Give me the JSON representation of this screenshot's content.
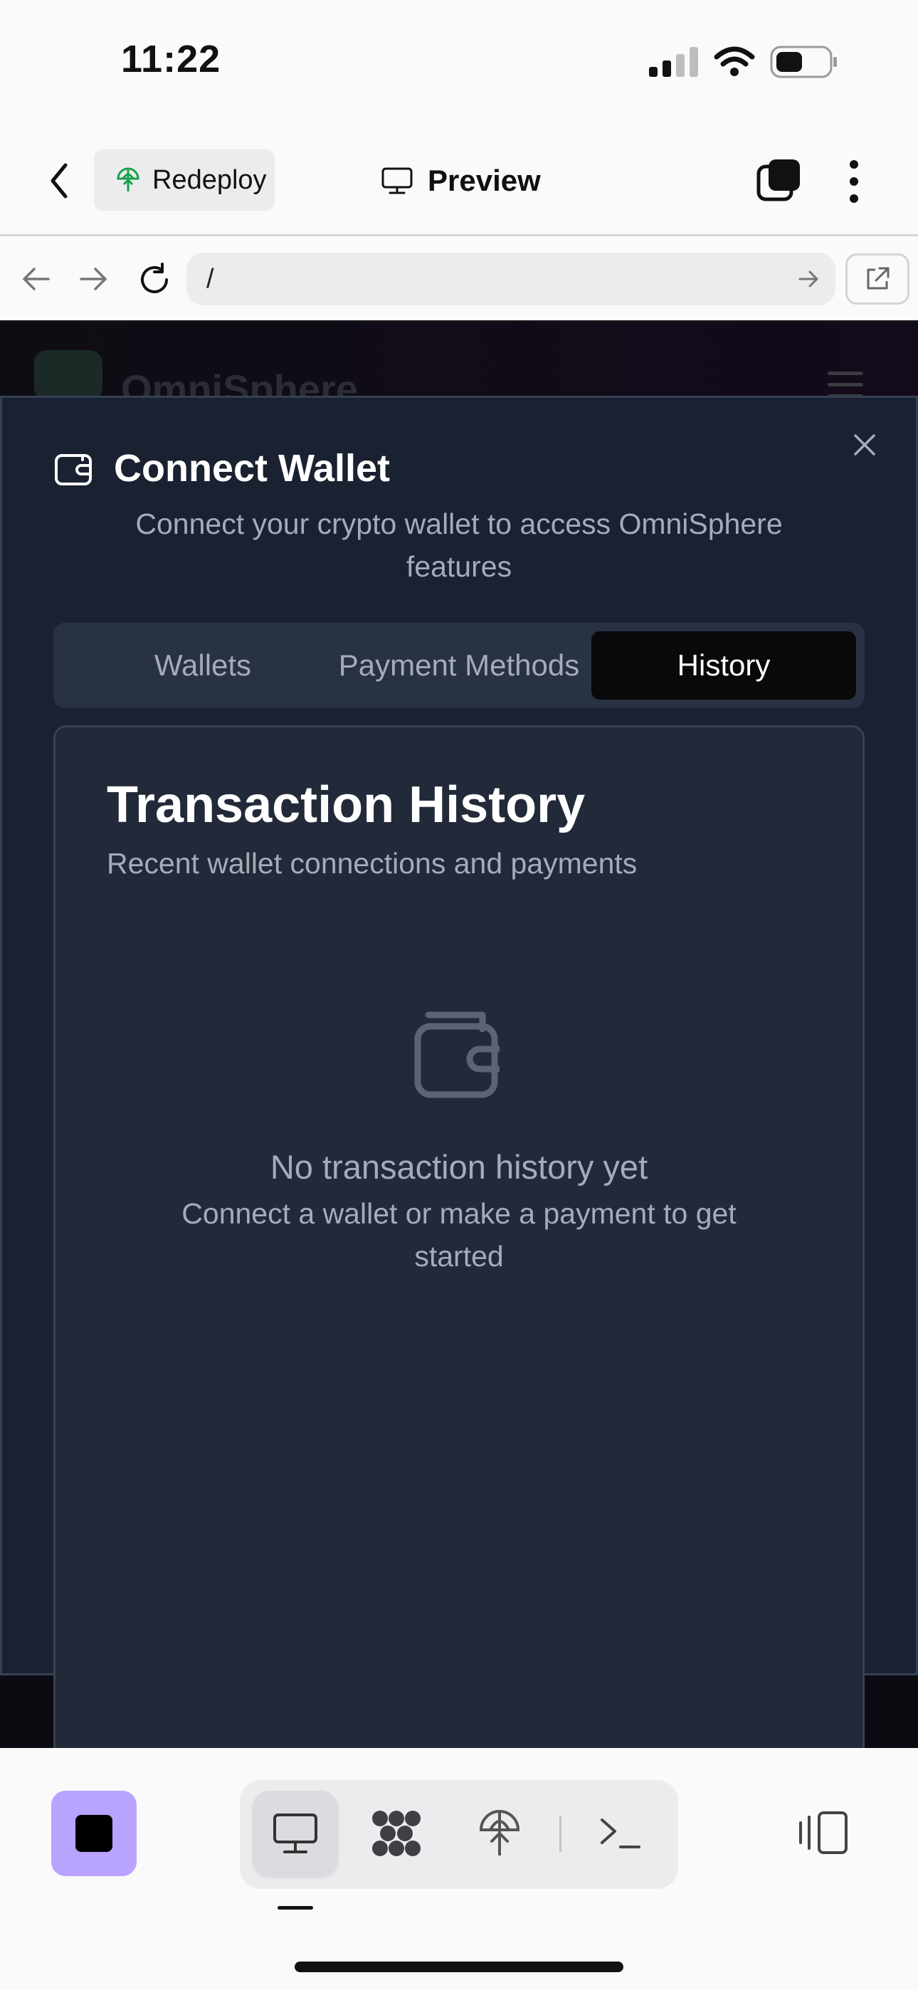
{
  "status_bar": {
    "time": "11:22"
  },
  "header": {
    "redeploy_label": "Redeploy",
    "title": "Preview"
  },
  "browser": {
    "url": "/"
  },
  "site": {
    "brand": "OmniSphere"
  },
  "modal": {
    "title": "Connect Wallet",
    "description": "Connect your crypto wallet to access OmniSphere features",
    "tabs": [
      {
        "label": "Wallets",
        "active": false
      },
      {
        "label": "Payment Methods",
        "active": false
      },
      {
        "label": "History",
        "active": true
      }
    ],
    "card": {
      "title": "Transaction History",
      "subtitle": "Recent wallet connections and payments",
      "empty_title": "No transaction history yet",
      "empty_description": "Connect a wallet or make a payment to get started"
    }
  },
  "toolbar": {
    "tools": [
      "desktop-icon",
      "modules-icon",
      "deploy-icon",
      "terminal-icon"
    ],
    "active_tool": "desktop-icon"
  },
  "colors": {
    "modal_bg": "#1a2130",
    "card_bg": "#222a39",
    "active_tab_bg": "#09090b",
    "stop_button": "#b8a4ff",
    "muted_text": "#a4acb9"
  }
}
